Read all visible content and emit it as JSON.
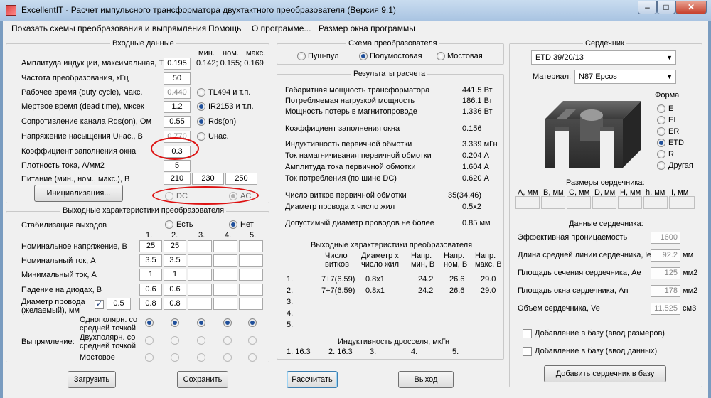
{
  "window": {
    "title": "ExcellentIT - Расчет импульсного трансформатора двухтактного преобразователя (Версия 9.1)",
    "minimize": "–",
    "maximize": "□",
    "close": "✕"
  },
  "menu": [
    "Показать схемы преобразования и выпрямления",
    "Помощь",
    "О программе...",
    "Размер окна программы"
  ],
  "input": {
    "title": "Входные данные",
    "hdr_min": "мин.",
    "hdr_nom": "ном.",
    "hdr_max": "макс.",
    "rows": [
      {
        "label": "Амплитуда индукции, максимальная, Т",
        "value": "0.195",
        "note": "0.142; 0.155; 0.169"
      },
      {
        "label": "Частота преобразования, кГц",
        "value": "50"
      },
      {
        "label": "Рабочее время (duty cycle), макс.",
        "value": "0.440",
        "radio": "TL494 и т.п."
      },
      {
        "label": "Мертвое время (dead time), мксек",
        "value": "1.2",
        "radio": "IR2153 и т.п."
      },
      {
        "label": "Сопротивление канала Rds(on), Ом",
        "value": "0.55",
        "radio": "Rds(on)"
      },
      {
        "label": "Напряжение насыщения Uнас., В",
        "value": "0.770",
        "radio": "Uнас."
      },
      {
        "label": "Коэффициент заполнения окна",
        "value": "0.3"
      },
      {
        "label": "Плотность тока, А/мм2",
        "value": "5"
      },
      {
        "label": "Питание (мин., ном., макс.), В",
        "values": [
          "210",
          "230",
          "250"
        ]
      }
    ],
    "init_button": "Инициализация...",
    "dc": "DC",
    "ac": "AC"
  },
  "output_chars": {
    "title": "Выходные характеристики преобразователя",
    "stab_label": "Стабилизация выходов",
    "stab_yes": "Есть",
    "stab_no": "Нет",
    "col_nums": [
      "1.",
      "2.",
      "3.",
      "4.",
      "5."
    ],
    "rows": [
      {
        "label": "Номинальное напряжение, В",
        "values": [
          "25",
          "25",
          "",
          "",
          ""
        ]
      },
      {
        "label": "Номинальный ток, А",
        "values": [
          "3.5",
          "3.5",
          "",
          "",
          ""
        ]
      },
      {
        "label": "Минимальный ток, А",
        "values": [
          "1",
          "1",
          "",
          "",
          ""
        ]
      },
      {
        "label": "Падение на диодах, В",
        "values": [
          "0.6",
          "0.6",
          "",
          "",
          ""
        ]
      }
    ],
    "wire_label_1": "Диаметр провода",
    "wire_label_2": "(желаемый), мм",
    "wire_value": "0.5",
    "wire_values": [
      "0.8",
      "0.8",
      "",
      "",
      ""
    ],
    "rect_label": "Выпрямление:",
    "rect_opts": [
      "Однополярн. со средней точкой",
      "Двухполярн. со средней точкой",
      "Мостовое"
    ]
  },
  "scheme": {
    "title": "Схема преобразователя",
    "opts": [
      "Пуш-пул",
      "Полумостовая",
      "Мостовая"
    ]
  },
  "results": {
    "title": "Результаты расчета",
    "lines": [
      {
        "label": "Габаритная мощность трансформатора",
        "value": "441.5 Вт"
      },
      {
        "label": "Потребляемая нагрузкой мощность",
        "value": "186.1 Вт"
      },
      {
        "label": "Мощность потерь в магнитопроводе",
        "value": "1.336 Вт"
      },
      {
        "label": "Коэффициент заполнения окна",
        "value": "0.156"
      },
      {
        "label": "Индуктивность первичной обмотки",
        "value": "3.339 мГн"
      },
      {
        "label": "Ток намагничивания первичной обмотки",
        "value": "0.204 А"
      },
      {
        "label": "Амплитуда тока первичной обмотки",
        "value": "1.604 А"
      },
      {
        "label": "Ток потребления (по шине DC)",
        "value": "0.620 А"
      },
      {
        "label": "Число витков первичной обмотки",
        "value": "35(34.46)"
      },
      {
        "label": "Диаметр провода х число жил",
        "value": "0.5x2"
      },
      {
        "label": "Допустимый диаметр проводов не более",
        "value": "0.85 мм"
      }
    ],
    "out_title": "Выходные характеристики преобразователя",
    "out_headers": [
      [
        "Число",
        "витков"
      ],
      [
        "Диаметр х",
        "число жил"
      ],
      [
        "Напр.",
        "мин, В"
      ],
      [
        "Напр.",
        "ном, В"
      ],
      [
        "Напр.",
        "макс, В"
      ]
    ],
    "out_rows": [
      {
        "n": "1.",
        "turns": "7+7(6.59)",
        "wire": "0.8x1",
        "vmin": "24.2",
        "vnom": "26.6",
        "vmax": "29.0"
      },
      {
        "n": "2.",
        "turns": "7+7(6.59)",
        "wire": "0.8x1",
        "vmin": "24.2",
        "vnom": "26.6",
        "vmax": "29.0"
      },
      {
        "n": "3."
      },
      {
        "n": "4."
      },
      {
        "n": "5."
      }
    ],
    "choke_title": "Индуктивность дросселя, мкГн",
    "choke": [
      "1. 16.3",
      "2. 16.3",
      "3.",
      "4.",
      "5."
    ]
  },
  "core": {
    "title": "Сердечник",
    "core_select": "ETD 39/20/13",
    "material_label": "Материал:",
    "material_select": "N87 Epcos",
    "shape_label": "Форма",
    "shapes": [
      "E",
      "EI",
      "ER",
      "ETD",
      "R",
      "Другая"
    ],
    "dims_title": "Размеры сердечника:",
    "dims": [
      "A, мм",
      "B, мм",
      "C, мм",
      "D, мм",
      "H, мм",
      "h, мм",
      "I, мм"
    ],
    "data_title": "Данные сердечника:",
    "data": [
      {
        "label": "Эффективная проницаемость",
        "value": "1600",
        "unit": ""
      },
      {
        "label": "Длина средней линии сердечника, le",
        "value": "92.2",
        "unit": "мм"
      },
      {
        "label": "Площадь сечения сердечника, Ae",
        "value": "125",
        "unit": "мм2"
      },
      {
        "label": "Площадь окна сердечника, An",
        "value": "178",
        "unit": "мм2"
      },
      {
        "label": "Объем сердечника, Ve",
        "value": "11.525",
        "unit": "см3"
      }
    ],
    "add_dims": "Добавление в базу (ввод размеров)",
    "add_data": "Добавление в базу (ввод данных)",
    "add_button": "Добавить сердечник в базу"
  },
  "bottom": {
    "load": "Загрузить",
    "save": "Сохранить",
    "calc": "Рассчитать",
    "exit": "Выход"
  }
}
